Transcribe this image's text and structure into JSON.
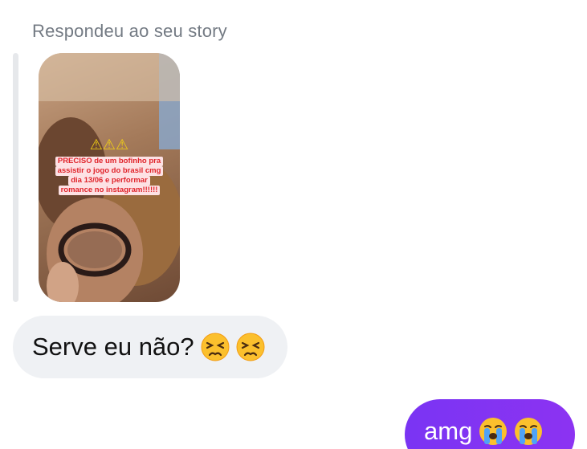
{
  "reply_header": {
    "label": "Respondeu ao seu story"
  },
  "story": {
    "warning_icons": "⚠⚠⚠",
    "caption_lines": [
      "PRECISO de um bofinho pra",
      "assistir o jogo do brasil cmg",
      "dia 13/06 e performar",
      "romance no instagram!!!!!!"
    ]
  },
  "messages": {
    "incoming": {
      "text": "Serve eu não?",
      "emojis": [
        "persevering-face-emoji",
        "persevering-face-emoji"
      ]
    },
    "outgoing": {
      "text": "amg",
      "emojis": [
        "loudly-crying-face-emoji",
        "loudly-crying-face-emoji"
      ]
    }
  },
  "colors": {
    "outgoing_bubble": "#7a34f3",
    "incoming_bubble": "#eff1f4",
    "caption_text": "#e0242b",
    "label_gray": "#737a83"
  }
}
